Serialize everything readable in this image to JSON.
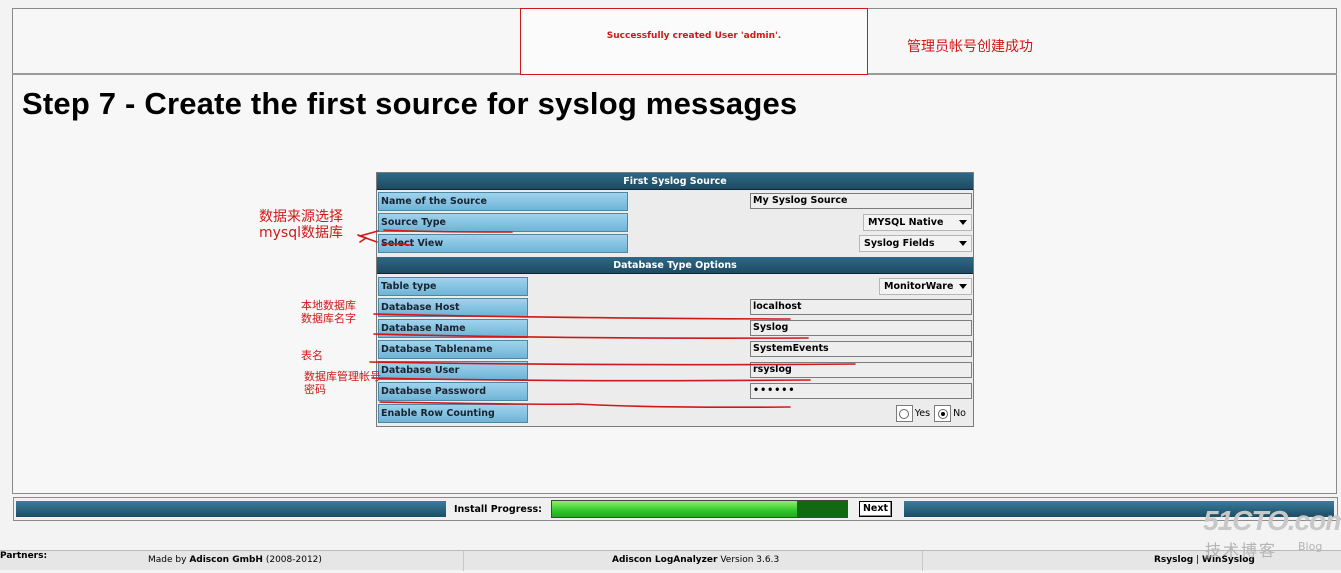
{
  "banner": {
    "success_message": "Successfully created User 'admin'.",
    "annotation": "管理员帐号创建成功"
  },
  "step_title": "Step 7 - Create the first source for syslog messages",
  "form": {
    "section1_title": "First Syslog Source",
    "name_label": "Name of the Source",
    "name_value": "My Syslog Source",
    "source_type_label": "Source Type",
    "source_type_value": "MYSQL Native",
    "select_view_label": "Select View",
    "select_view_value": "Syslog Fields",
    "section2_title": "Database Type Options",
    "table_type_label": "Table type",
    "table_type_value": "MonitorWare",
    "db_host_label": "Database Host",
    "db_host_value": "localhost",
    "db_name_label": "Database Name",
    "db_name_value": "Syslog",
    "db_table_label": "Database Tablename",
    "db_table_value": "SystemEvents",
    "db_user_label": "Database User",
    "db_user_value": "rsyslog",
    "db_password_label": "Database Password",
    "db_password_value": "••••••",
    "row_counting_label": "Enable Row Counting",
    "yes_label": "Yes",
    "no_label": "No",
    "row_counting_selected": "No"
  },
  "annotations": {
    "source_type_line1": "数据来源选择",
    "source_type_line2": "mysql数据库",
    "db_host": "本地数据库",
    "db_name": "数据库名字",
    "tablename": "表名",
    "db_user": "数据库管理帐号",
    "db_password": "密码"
  },
  "progress": {
    "label": "Install Progress:",
    "fraction": 0.83,
    "next_label": "Next"
  },
  "footer": {
    "made_by_prefix": "Made by",
    "made_by_company": "Adiscon GmbH",
    "made_by_years": "(2008-2012)",
    "product_name": "Adiscon LogAnalyzer",
    "product_version": "Version 3.6.3",
    "partners_label": "Partners:",
    "partner1": "Rsyslog",
    "separator": "|",
    "partner2": "WinSyslog"
  },
  "watermark": {
    "site": "51CTO.com",
    "sub": "技术博客",
    "blog": "Blog"
  },
  "colors": {
    "annotation_red": "#d01818",
    "header_blue": "#1e4a63",
    "label_blue": "#8cc6e6",
    "progress_green": "#2fc72a"
  }
}
